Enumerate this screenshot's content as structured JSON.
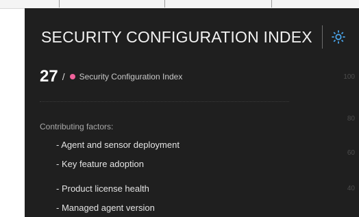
{
  "header": {
    "title": "SECURITY CONFIGURATION INDEX",
    "settings_icon": "gear-icon"
  },
  "score": {
    "value": "27",
    "separator": "/",
    "dot_color": "#f0629b",
    "label": "Security Configuration Index"
  },
  "factors": {
    "heading": "Contributing factors:",
    "items": [
      "- Agent and sensor deployment",
      "- Key feature adoption",
      "- Product license health",
      "- Managed agent version"
    ]
  },
  "axis": {
    "ticks": [
      "100",
      "80",
      "60",
      "40"
    ]
  },
  "colors": {
    "panel_background": "#1f1f1f",
    "accent": "#f0629b",
    "icon_blue": "#4aa3e8"
  }
}
